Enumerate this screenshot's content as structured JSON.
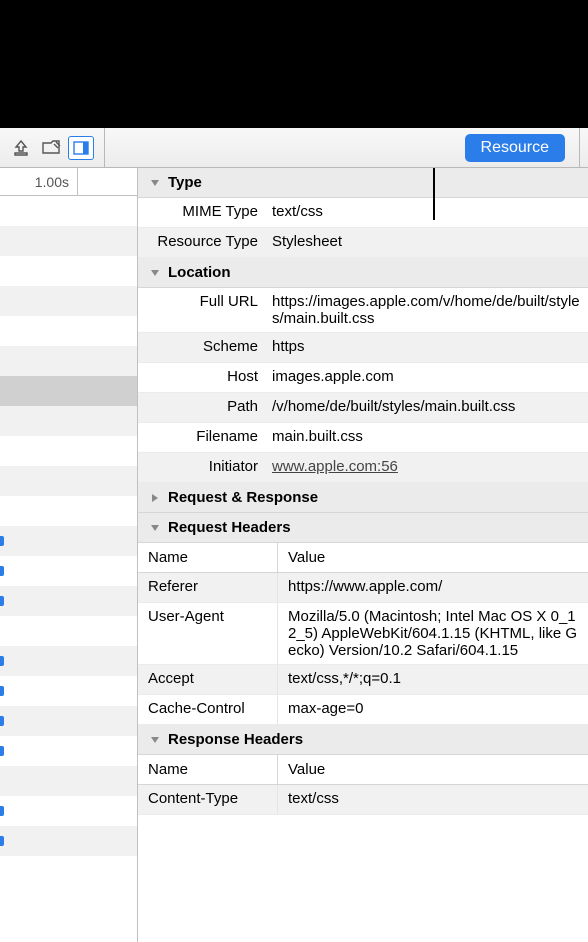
{
  "toolbar": {
    "resource_tab": "Resource"
  },
  "timeline": {
    "time_label": "1.00s",
    "row_count": 23,
    "selected_row": 6,
    "bar_rows": [
      11,
      12,
      13,
      15,
      16,
      17,
      18,
      20,
      21
    ]
  },
  "sections": {
    "type": {
      "title": "Type",
      "mime_type_label": "MIME Type",
      "mime_type_value": "text/css",
      "resource_type_label": "Resource Type",
      "resource_type_value": "Stylesheet"
    },
    "location": {
      "title": "Location",
      "full_url_label": "Full URL",
      "full_url_value": "https://images.apple.com/v/home/de/built/styles/main.built.css",
      "scheme_label": "Scheme",
      "scheme_value": "https",
      "host_label": "Host",
      "host_value": "images.apple.com",
      "path_label": "Path",
      "path_value": "/v/home/de/built/styles/main.built.css",
      "filename_label": "Filename",
      "filename_value": "main.built.css",
      "initiator_label": "Initiator",
      "initiator_value": "www.apple.com:56"
    },
    "request_response": {
      "title": "Request & Response"
    },
    "request_headers": {
      "title": "Request Headers",
      "col_name": "Name",
      "col_value": "Value",
      "rows": [
        {
          "name": "Referer",
          "value": "https://www.apple.com/"
        },
        {
          "name": "User-Agent",
          "value": "Mozilla/5.0 (Macintosh; Intel Mac OS X 0_12_5) AppleWebKit/604.1.15 (KHTML, like Gecko) Version/10.2 Safari/604.1.15"
        },
        {
          "name": "Accept",
          "value": "text/css,*/*;q=0.1"
        },
        {
          "name": "Cache-Control",
          "value": "max-age=0"
        }
      ]
    },
    "response_headers": {
      "title": "Response Headers",
      "col_name": "Name",
      "col_value": "Value",
      "rows": [
        {
          "name": "Content-Type",
          "value": "text/css"
        }
      ]
    }
  }
}
